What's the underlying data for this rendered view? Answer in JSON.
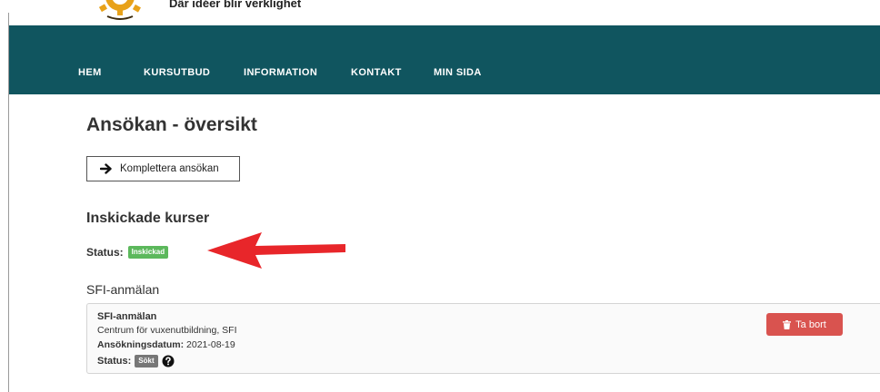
{
  "header": {
    "tagline": "Där idéer blir verklighet",
    "logo": "gear-logo"
  },
  "nav": {
    "items": [
      "HEM",
      "KURSUTBUD",
      "INFORMATION",
      "KONTAKT",
      "MIN SIDA"
    ]
  },
  "main": {
    "title": "Ansökan - översikt",
    "complete_button": {
      "label": "Komplettera ansökan",
      "icon": "arrow-right-icon"
    },
    "section_title": "Inskickade kurser",
    "status_label": "Status:",
    "status_badge": "Inskickad",
    "subheading": "SFI-anmälan",
    "card": {
      "title": "SFI-anmälan",
      "school": "Centrum för vuxenutbildning, SFI",
      "date_label": "Ansökningsdatum:",
      "date_value": "2021-08-19",
      "status_label": "Status:",
      "status_badge": "Sökt",
      "help_icon": "question-circle-icon",
      "delete_label": "Ta bort",
      "delete_icon": "trash-icon"
    }
  },
  "annotation": {
    "icon": "red-arrow-icon"
  },
  "colors": {
    "navbar": "#10555f",
    "badge_green": "#5cb85c",
    "badge_gray": "#777777",
    "delete_red": "#d9534f",
    "annotation_red": "#e8262a",
    "logo_orange": "#e8a21a"
  }
}
